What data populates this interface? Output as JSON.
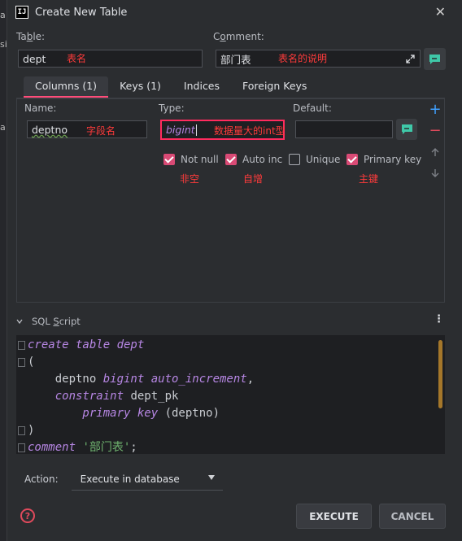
{
  "window": {
    "title": "Create New Table",
    "app_icon_text": "IJ"
  },
  "edge": {
    "fragments": [
      "a",
      "si)",
      "a"
    ]
  },
  "form": {
    "table_label_prefix": "Ta",
    "table_label_underline": "b",
    "table_label_suffix": "le:",
    "table_value": "dept",
    "table_note": "表名",
    "comment_label_prefix": "C",
    "comment_label_underline": "o",
    "comment_label_suffix": "mment:",
    "comment_value": "部门表",
    "comment_note": "表名的说明"
  },
  "tabs": [
    {
      "label": "Columns (1)",
      "active": true
    },
    {
      "label": "Keys (1)",
      "active": false
    },
    {
      "label": "Indices",
      "active": false
    },
    {
      "label": "Foreign Keys",
      "active": false
    }
  ],
  "column": {
    "name_label": "Name:",
    "name_value": "deptno",
    "name_note": "字段名",
    "type_label": "Type:",
    "type_value": "bigint",
    "type_note": "数据量大的int型",
    "default_label": "Default:",
    "default_value": "",
    "checks": [
      {
        "label": "Not null",
        "checked": true,
        "note": "非空"
      },
      {
        "label": "Auto inc",
        "checked": true,
        "note": "自增"
      },
      {
        "label": "Unique",
        "checked": false,
        "note": ""
      },
      {
        "label": "Primary key",
        "checked": true,
        "note": "主键"
      }
    ]
  },
  "sql": {
    "section_label": "SQL Script",
    "lines": [
      [
        [
          "kw",
          "create table "
        ],
        [
          "kw2",
          "dept"
        ]
      ],
      [
        [
          "id",
          "("
        ]
      ],
      [
        [
          "id",
          "    deptno "
        ],
        [
          "kw",
          "bigint auto_increment"
        ],
        [
          "id",
          ","
        ]
      ],
      [
        [
          "kw",
          "    constraint "
        ],
        [
          "id",
          "dept_pk"
        ]
      ],
      [
        [
          "kw",
          "        primary key "
        ],
        [
          "id",
          "(deptno)"
        ]
      ],
      [
        [
          "id",
          ")"
        ]
      ],
      [
        [
          "kw",
          "comment "
        ],
        [
          "str",
          "'部门表'"
        ],
        [
          "id",
          ";"
        ]
      ]
    ]
  },
  "action": {
    "label": "Action:",
    "value": "Execute in database"
  },
  "buttons": {
    "execute": "EXECUTE",
    "cancel": "CANCEL",
    "help": "?"
  },
  "colors": {
    "accent_red": "#ff3b3b",
    "checkbox_pink": "#d94a75",
    "tab_underline": "#ff4c7a",
    "keyword_purple": "#b686e3",
    "string_green": "#6fb36f"
  }
}
